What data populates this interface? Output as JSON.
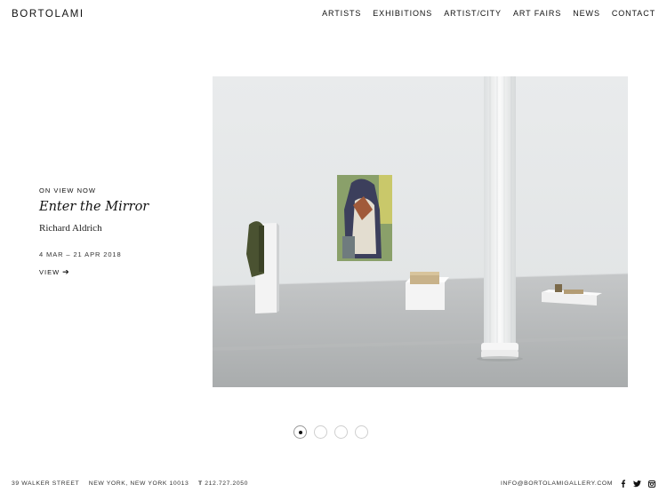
{
  "header": {
    "logo": "BORTOLAMI",
    "nav": [
      "ARTISTS",
      "EXHIBITIONS",
      "ARTIST/CITY",
      "ART FAIRS",
      "NEWS",
      "CONTACT"
    ]
  },
  "feature": {
    "kicker": "ON VIEW NOW",
    "title": "Enter the Mirror",
    "artist": "Richard Aldrich",
    "dates": "4 MAR – 21 APR 2018",
    "view_label": "VIEW",
    "arrow_icon": "arrow-right-icon"
  },
  "slider": {
    "count": 4,
    "active_index": 1
  },
  "footer": {
    "street": "39 WALKER STREET",
    "city": "NEW YORK, NEW YORK 10013",
    "phone_prefix": "T",
    "phone": "212.727.2050",
    "email": "INFO@BORTOLAMIGALLERY.COM",
    "social_icons": [
      "facebook-icon",
      "twitter-icon",
      "instagram-icon"
    ]
  },
  "colors": {
    "text": "#111111",
    "background": "#ffffff"
  }
}
